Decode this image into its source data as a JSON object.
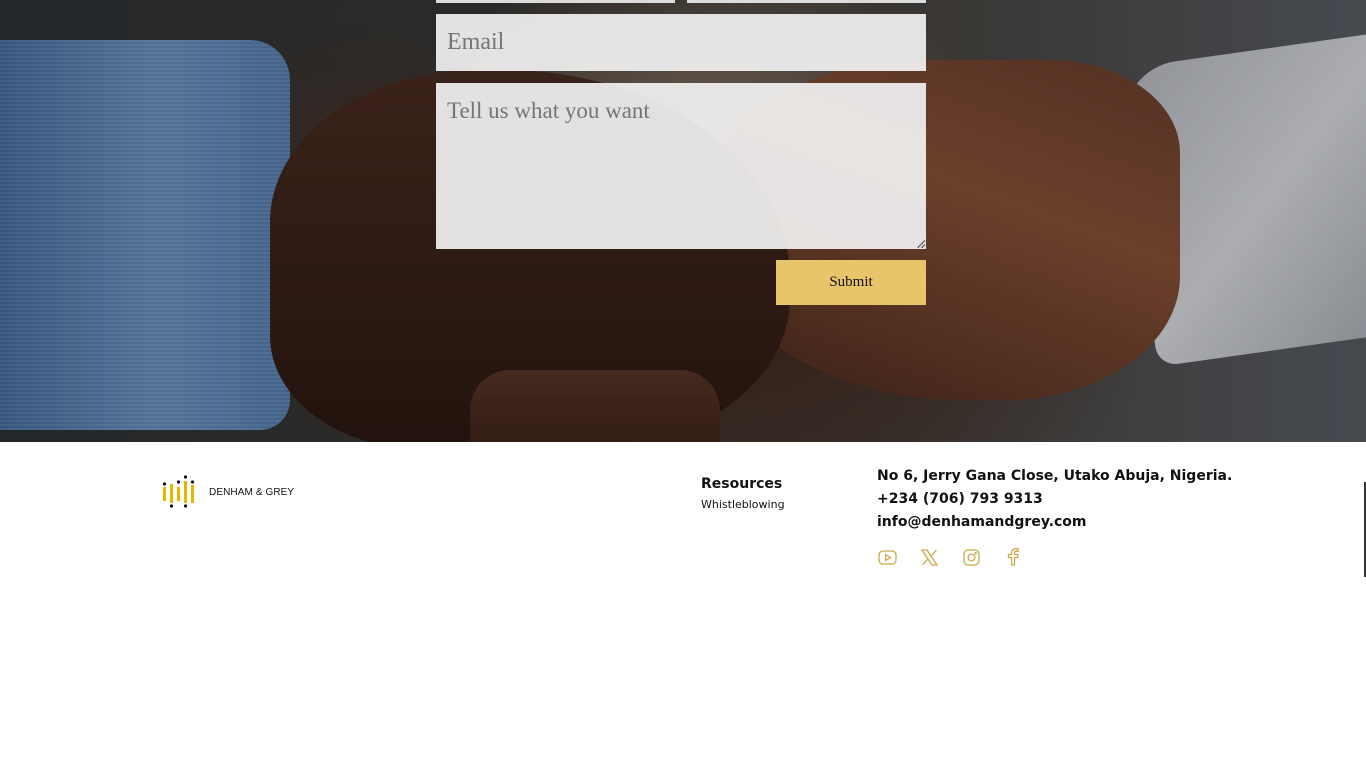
{
  "form": {
    "email_placeholder": "Email",
    "message_placeholder": "Tell us what you want",
    "submit_label": "Submit"
  },
  "footer": {
    "brand_name": "DENHAM & GREY",
    "resources": {
      "title": "Resources",
      "links": [
        "Whistleblowing"
      ]
    },
    "contact": {
      "address": "No 6, Jerry Gana Close, Utako Abuja, Nigeria.",
      "phone": "+234 (706) 793 9313",
      "email": "info@denhamandgrey.com"
    },
    "socials": [
      "youtube-icon",
      "x-twitter-icon",
      "instagram-icon",
      "facebook-icon"
    ]
  },
  "colors": {
    "accent": "#e8c46a",
    "icon_gold": "#c9a94b",
    "text": "#111111"
  }
}
